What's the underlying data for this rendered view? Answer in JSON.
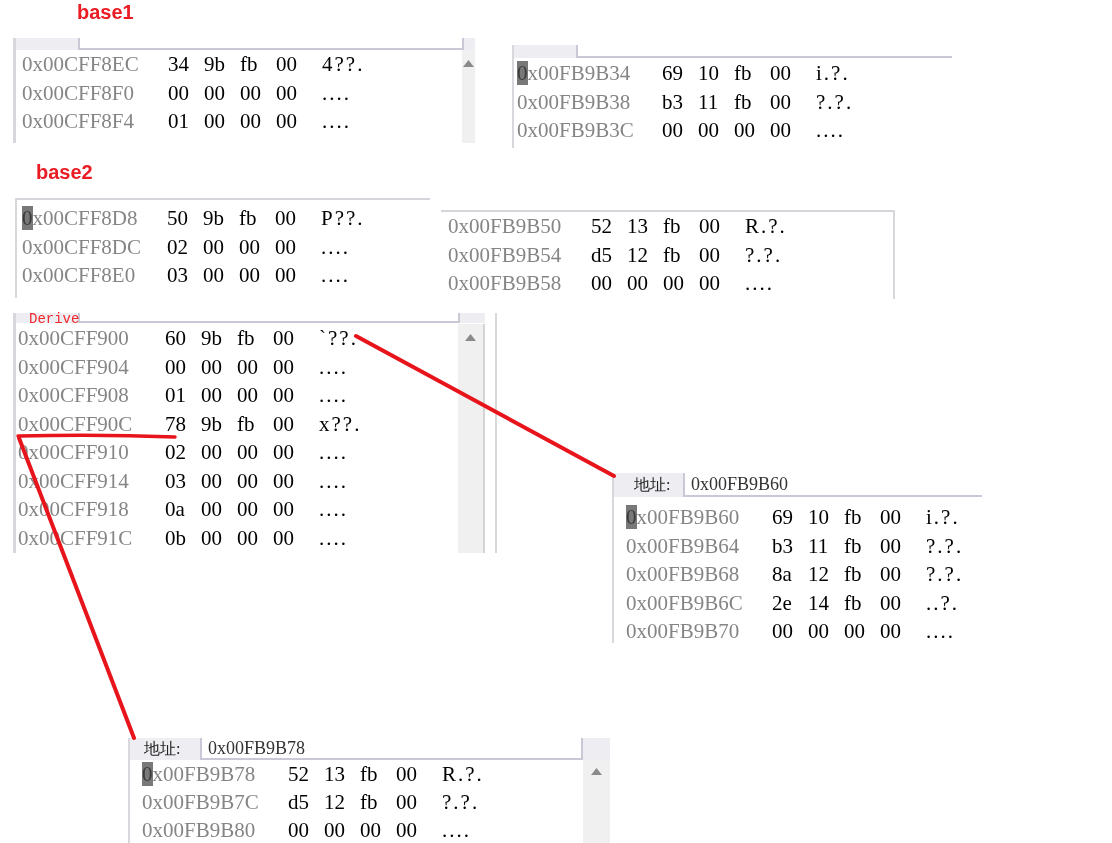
{
  "annotations": [
    {
      "kind": "heading",
      "text": "base1"
    },
    {
      "kind": "heading",
      "text": "base2"
    },
    {
      "kind": "tag",
      "text": "Derive"
    }
  ],
  "memory_panels": [
    {
      "header": {
        "kind": "field"
      },
      "scrollbar": true,
      "cursor": false,
      "rows": [
        {
          "address": "0x00CFF8EC",
          "bytes": [
            "34",
            "9b",
            "fb",
            "00"
          ],
          "ascii": "4??."
        },
        {
          "address": "0x00CFF8F0",
          "bytes": [
            "00",
            "00",
            "00",
            "00"
          ],
          "ascii": "...."
        },
        {
          "address": "0x00CFF8F4",
          "bytes": [
            "01",
            "00",
            "00",
            "00"
          ],
          "ascii": "...."
        }
      ]
    },
    {
      "header": {
        "kind": "field"
      },
      "scrollbar": false,
      "cursor": true,
      "rows": [
        {
          "address": "0x00FB9B34",
          "bytes": [
            "69",
            "10",
            "fb",
            "00"
          ],
          "ascii": "i.?."
        },
        {
          "address": "0x00FB9B38",
          "bytes": [
            "b3",
            "11",
            "fb",
            "00"
          ],
          "ascii": "?.?."
        },
        {
          "address": "0x00FB9B3C",
          "bytes": [
            "00",
            "00",
            "00",
            "00"
          ],
          "ascii": "...."
        }
      ]
    },
    {
      "header": {
        "kind": "line"
      },
      "scrollbar": false,
      "cursor": true,
      "rows": [
        {
          "address": "0x00CFF8D8",
          "bytes": [
            "50",
            "9b",
            "fb",
            "00"
          ],
          "ascii": "P??."
        },
        {
          "address": "0x00CFF8DC",
          "bytes": [
            "02",
            "00",
            "00",
            "00"
          ],
          "ascii": "...."
        },
        {
          "address": "0x00CFF8E0",
          "bytes": [
            "03",
            "00",
            "00",
            "00"
          ],
          "ascii": "...."
        }
      ]
    },
    {
      "header": {
        "kind": "line"
      },
      "scrollbar": false,
      "cursor": false,
      "rows": [
        {
          "address": "0x00FB9B50",
          "bytes": [
            "52",
            "13",
            "fb",
            "00"
          ],
          "ascii": "R.?."
        },
        {
          "address": "0x00FB9B54",
          "bytes": [
            "d5",
            "12",
            "fb",
            "00"
          ],
          "ascii": "?.?."
        },
        {
          "address": "0x00FB9B58",
          "bytes": [
            "00",
            "00",
            "00",
            "00"
          ],
          "ascii": "...."
        }
      ]
    },
    {
      "header": {
        "kind": "field"
      },
      "scrollbar": true,
      "cursor": false,
      "rows": [
        {
          "address": "0x00CFF900",
          "bytes": [
            "60",
            "9b",
            "fb",
            "00"
          ],
          "ascii": "`??."
        },
        {
          "address": "0x00CFF904",
          "bytes": [
            "00",
            "00",
            "00",
            "00"
          ],
          "ascii": "...."
        },
        {
          "address": "0x00CFF908",
          "bytes": [
            "01",
            "00",
            "00",
            "00"
          ],
          "ascii": "...."
        },
        {
          "address": "0x00CFF90C",
          "bytes": [
            "78",
            "9b",
            "fb",
            "00"
          ],
          "ascii": "x??."
        },
        {
          "address": "0x00CFF910",
          "bytes": [
            "02",
            "00",
            "00",
            "00"
          ],
          "ascii": "...."
        },
        {
          "address": "0x00CFF914",
          "bytes": [
            "03",
            "00",
            "00",
            "00"
          ],
          "ascii": "...."
        },
        {
          "address": "0x00CFF918",
          "bytes": [
            "0a",
            "00",
            "00",
            "00"
          ],
          "ascii": "...."
        },
        {
          "address": "0x00CFF91C",
          "bytes": [
            "0b",
            "00",
            "00",
            "00"
          ],
          "ascii": "...."
        }
      ]
    },
    {
      "header": {
        "kind": "address",
        "label": "地址:",
        "value": "0x00FB9B60"
      },
      "scrollbar": false,
      "cursor": true,
      "rows": [
        {
          "address": "0x00FB9B60",
          "bytes": [
            "69",
            "10",
            "fb",
            "00"
          ],
          "ascii": "i.?."
        },
        {
          "address": "0x00FB9B64",
          "bytes": [
            "b3",
            "11",
            "fb",
            "00"
          ],
          "ascii": "?.?."
        },
        {
          "address": "0x00FB9B68",
          "bytes": [
            "8a",
            "12",
            "fb",
            "00"
          ],
          "ascii": "?.?."
        },
        {
          "address": "0x00FB9B6C",
          "bytes": [
            "2e",
            "14",
            "fb",
            "00"
          ],
          "ascii": "..?."
        },
        {
          "address": "0x00FB9B70",
          "bytes": [
            "00",
            "00",
            "00",
            "00"
          ],
          "ascii": "...."
        }
      ]
    },
    {
      "header": {
        "kind": "address",
        "label": "地址:",
        "value": "0x00FB9B78"
      },
      "scrollbar": true,
      "cursor": true,
      "rows": [
        {
          "address": "0x00FB9B78",
          "bytes": [
            "52",
            "13",
            "fb",
            "00"
          ],
          "ascii": "R.?."
        },
        {
          "address": "0x00FB9B7C",
          "bytes": [
            "d5",
            "12",
            "fb",
            "00"
          ],
          "ascii": "?.?."
        },
        {
          "address": "0x00FB9B80",
          "bytes": [
            "00",
            "00",
            "00",
            "00"
          ],
          "ascii": "...."
        }
      ]
    }
  ]
}
